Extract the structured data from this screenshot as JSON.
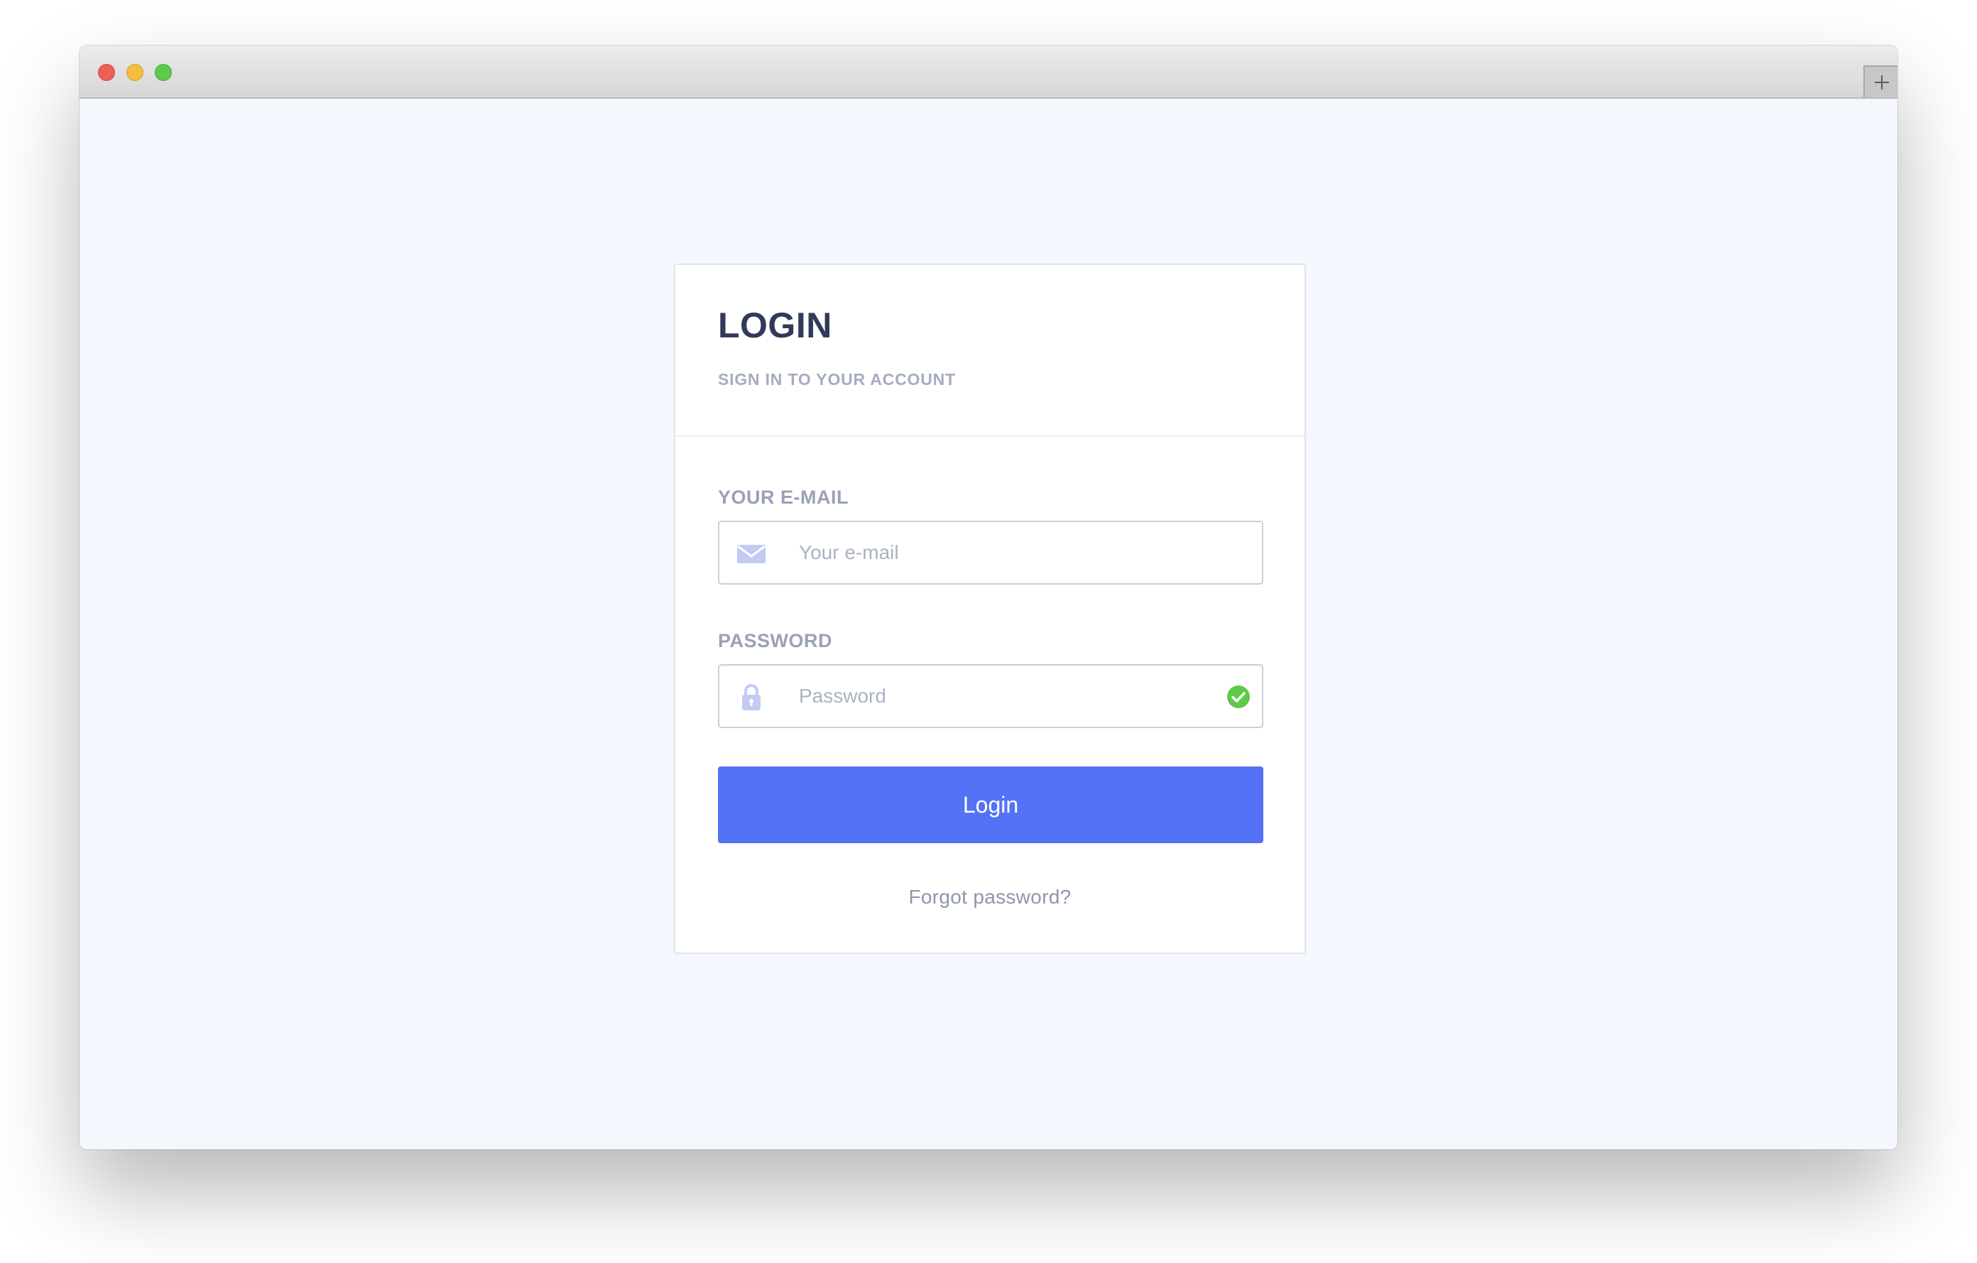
{
  "window": {
    "controls": {
      "close_color": "#ee5f57",
      "minimize_color": "#f5bd3d",
      "zoom_color": "#5ec94a"
    },
    "new_tab_icon": "plus-icon"
  },
  "login_card": {
    "title": "LOGIN",
    "subtitle": "SIGN IN TO YOUR ACCOUNT",
    "email": {
      "label": "YOUR E-MAIL",
      "placeholder": "Your e-mail",
      "value": "",
      "icon": "envelope-icon"
    },
    "password": {
      "label": "PASSWORD",
      "placeholder": "Password",
      "value": "",
      "icon": "lock-icon",
      "status_icon": "check-circle-icon",
      "status_color": "#5ec94a"
    },
    "submit_label": "Login",
    "submit_color": "#5472f5",
    "forgot_label": "Forgot password?"
  }
}
